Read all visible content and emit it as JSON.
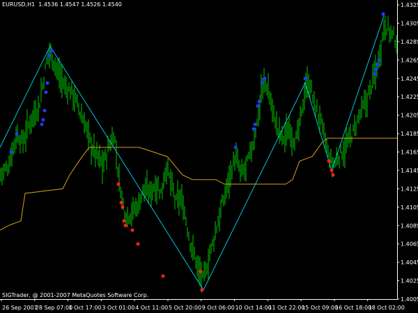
{
  "window": {
    "title": "EURUSD,H1  1.4536 1.4547 1.4526 1.4540",
    "copyright": "SIGTrader, @ 2001-2007 MetaQuotes Software Corp."
  },
  "colors": {
    "background": "#000000",
    "axis": "#ffffff",
    "bars": "#00c800",
    "zigzag": "#00c8d8",
    "moving_average": "#d8a020",
    "high_dots": "#1e3cff",
    "low_dots": "#ff1e1e"
  },
  "chart_data": {
    "type": "line",
    "symbol": "EURUSD",
    "timeframe": "H1",
    "ohlc_header": {
      "open": 1.4536,
      "high": 1.4547,
      "low": 1.4526,
      "close": 1.454
    },
    "price_ticks": [
      "1.4325",
      "1.4305",
      "1.4285",
      "1.4265",
      "1.4245",
      "1.4225",
      "1.4205",
      "1.4185",
      "1.4165",
      "1.4145",
      "1.4125",
      "1.4105",
      "1.4085",
      "1.4065",
      "1.4045",
      "1.4025",
      "1.4005"
    ],
    "time_ticks": [
      "26 Sep 2007",
      "28 Sep 07:00",
      "1 Oct 17:00",
      "3 Oct 01:00",
      "4 Oct 11:00",
      "5 Oct 20:00",
      "9 Oct 06:00",
      "10 Oct 14:00",
      "11 Oct 22:00",
      "15 Oct 09:00",
      "16 Oct 18:00",
      "18 Oct 02:00"
    ],
    "ylim": [
      1.4005,
      1.4325
    ],
    "price_path": [
      [
        0,
        1.414
      ],
      [
        12,
        1.415
      ],
      [
        24,
        1.4185
      ],
      [
        32,
        1.4175
      ],
      [
        44,
        1.42
      ],
      [
        56,
        1.4215
      ],
      [
        64,
        1.425
      ],
      [
        70,
        1.4275
      ],
      [
        74,
        1.427
      ],
      [
        84,
        1.425
      ],
      [
        94,
        1.4235
      ],
      [
        104,
        1.423
      ],
      [
        114,
        1.421
      ],
      [
        122,
        1.4195
      ],
      [
        132,
        1.417
      ],
      [
        140,
        1.416
      ],
      [
        148,
        1.415
      ],
      [
        158,
        1.4175
      ],
      [
        164,
        1.4185
      ],
      [
        170,
        1.414
      ],
      [
        176,
        1.411
      ],
      [
        182,
        1.4095
      ],
      [
        190,
        1.41
      ],
      [
        200,
        1.411
      ],
      [
        206,
        1.4125
      ],
      [
        214,
        1.412
      ],
      [
        224,
        1.413
      ],
      [
        232,
        1.412
      ],
      [
        238,
        1.415
      ],
      [
        246,
        1.413
      ],
      [
        252,
        1.411
      ],
      [
        260,
        1.4115
      ],
      [
        266,
        1.4095
      ],
      [
        272,
        1.407
      ],
      [
        280,
        1.405
      ],
      [
        286,
        1.4035
      ],
      [
        292,
        1.4025
      ],
      [
        300,
        1.405
      ],
      [
        310,
        1.408
      ],
      [
        320,
        1.411
      ],
      [
        330,
        1.414
      ],
      [
        338,
        1.416
      ],
      [
        346,
        1.414
      ],
      [
        354,
        1.415
      ],
      [
        362,
        1.417
      ],
      [
        370,
        1.42
      ],
      [
        376,
        1.4235
      ],
      [
        382,
        1.424
      ],
      [
        390,
        1.4215
      ],
      [
        398,
        1.419
      ],
      [
        406,
        1.418
      ],
      [
        416,
        1.419
      ],
      [
        424,
        1.4175
      ],
      [
        432,
        1.42
      ],
      [
        438,
        1.4235
      ],
      [
        444,
        1.424
      ],
      [
        452,
        1.4215
      ],
      [
        460,
        1.42
      ],
      [
        466,
        1.418
      ],
      [
        472,
        1.416
      ],
      [
        478,
        1.415
      ],
      [
        486,
        1.416
      ],
      [
        496,
        1.417
      ],
      [
        506,
        1.4185
      ],
      [
        516,
        1.4205
      ],
      [
        526,
        1.422
      ],
      [
        534,
        1.424
      ],
      [
        542,
        1.426
      ],
      [
        548,
        1.4285
      ],
      [
        552,
        1.4305
      ],
      [
        560,
        1.4295
      ],
      [
        570,
        1.4285
      ]
    ],
    "zigzag": [
      [
        0,
        1.417
      ],
      [
        72,
        1.428
      ],
      [
        292,
        1.4015
      ],
      [
        438,
        1.424
      ],
      [
        476,
        1.4145
      ],
      [
        552,
        1.4315
      ]
    ],
    "moving_average": [
      [
        0,
        1.408
      ],
      [
        12,
        1.4085
      ],
      [
        30,
        1.409
      ],
      [
        36,
        1.412
      ],
      [
        90,
        1.4125
      ],
      [
        100,
        1.414
      ],
      [
        118,
        1.416
      ],
      [
        128,
        1.417
      ],
      [
        200,
        1.417
      ],
      [
        240,
        1.416
      ],
      [
        262,
        1.414
      ],
      [
        276,
        1.4135
      ],
      [
        310,
        1.4135
      ],
      [
        322,
        1.413
      ],
      [
        410,
        1.413
      ],
      [
        420,
        1.4135
      ],
      [
        430,
        1.4155
      ],
      [
        448,
        1.416
      ],
      [
        462,
        1.4175
      ],
      [
        470,
        1.418
      ],
      [
        570,
        1.418
      ]
    ],
    "high_dots": [
      [
        16,
        1.4165
      ],
      [
        24,
        1.4185
      ],
      [
        60,
        1.4195
      ],
      [
        62,
        1.42
      ],
      [
        64,
        1.421
      ],
      [
        66,
        1.423
      ],
      [
        68,
        1.424
      ],
      [
        70,
        1.427
      ],
      [
        74,
        1.4275
      ],
      [
        338,
        1.417
      ],
      [
        364,
        1.419
      ],
      [
        366,
        1.4195
      ],
      [
        370,
        1.4215
      ],
      [
        372,
        1.422
      ],
      [
        376,
        1.424
      ],
      [
        380,
        1.4245
      ],
      [
        438,
        1.4245
      ],
      [
        538,
        1.425
      ],
      [
        540,
        1.4255
      ],
      [
        542,
        1.426
      ],
      [
        544,
        1.4265
      ],
      [
        550,
        1.4315
      ]
    ],
    "low_dots": [
      [
        170,
        1.413
      ],
      [
        174,
        1.411
      ],
      [
        176,
        1.4105
      ],
      [
        178,
        1.409
      ],
      [
        180,
        1.4085
      ],
      [
        190,
        1.408
      ],
      [
        198,
        1.4065
      ],
      [
        234,
        1.403
      ],
      [
        288,
        1.4035
      ],
      [
        290,
        1.4015
      ],
      [
        472,
        1.4155
      ],
      [
        476,
        1.4145
      ],
      [
        478,
        1.414
      ]
    ]
  }
}
